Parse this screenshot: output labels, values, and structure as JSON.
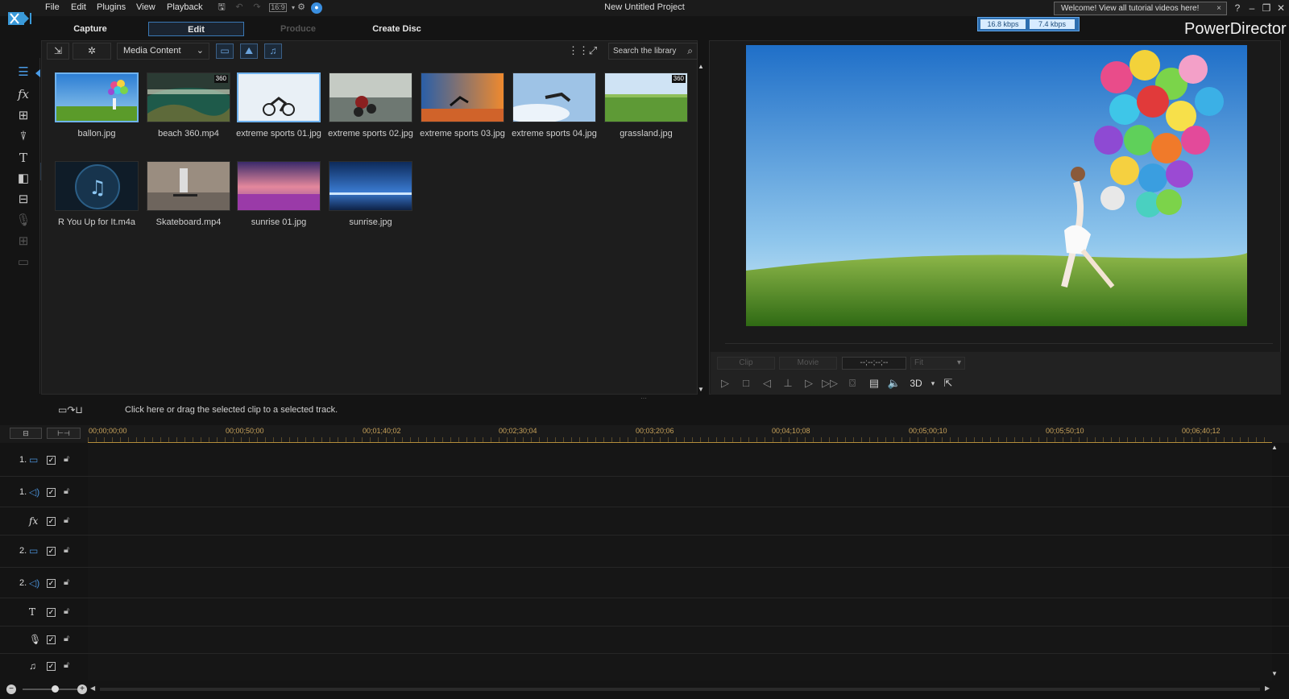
{
  "app": {
    "title": "New Untitled Project",
    "brand": "PowerDirector"
  },
  "menu": [
    "File",
    "Edit",
    "Plugins",
    "View",
    "Playback"
  ],
  "toolbar": {
    "aspect": "16:9"
  },
  "welcome": {
    "text": "Welcome! View all tutorial videos here!",
    "close": "×"
  },
  "modes": {
    "capture": "Capture",
    "edit": "Edit",
    "produce": "Produce",
    "create_disc": "Create Disc"
  },
  "bitrate": {
    "left": "16.8 kbps",
    "right": "7.4 kbps"
  },
  "library": {
    "content_type": "Media Content",
    "search_placeholder": "Search the library",
    "items": [
      {
        "name": "ballon.jpg",
        "badge": ""
      },
      {
        "name": "beach 360.mp4",
        "badge": "360"
      },
      {
        "name": "extreme sports 01.jpg",
        "badge": ""
      },
      {
        "name": "extreme sports 02.jpg",
        "badge": ""
      },
      {
        "name": "extreme sports 03.jpg",
        "badge": ""
      },
      {
        "name": "extreme sports 04.jpg",
        "badge": ""
      },
      {
        "name": "grassland.jpg",
        "badge": "360"
      },
      {
        "name": "R You Up for It.m4a",
        "badge": ""
      },
      {
        "name": "Skateboard.mp4",
        "badge": ""
      },
      {
        "name": "sunrise 01.jpg",
        "badge": ""
      },
      {
        "name": "sunrise.jpg",
        "badge": ""
      }
    ]
  },
  "preview": {
    "clip_label": "Clip",
    "movie_label": "Movie",
    "timecode": "--;--;--;--",
    "fit": "Fit",
    "mode_3d": "3D"
  },
  "timeline": {
    "hint": "Click here or drag the selected clip to a selected track.",
    "timecodes": [
      "00;00;00;00",
      "00;00;50;00",
      "00;01;40;02",
      "00;02;30;04",
      "00;03;20;06",
      "00;04;10;08",
      "00;05;00;10",
      "00;05;50;10",
      "00;06;40;12"
    ],
    "tracks": [
      {
        "num": "1.",
        "icon": "video"
      },
      {
        "num": "1.",
        "icon": "audio"
      },
      {
        "num": "",
        "icon": "fx"
      },
      {
        "num": "2.",
        "icon": "video"
      },
      {
        "num": "2.",
        "icon": "audio"
      },
      {
        "num": "",
        "icon": "title"
      },
      {
        "num": "",
        "icon": "voice"
      },
      {
        "num": "",
        "icon": "music"
      }
    ]
  },
  "colors": {
    "accent": "#3a78b5",
    "timecode": "#c8a25a",
    "selection": "#6fb2ee"
  }
}
